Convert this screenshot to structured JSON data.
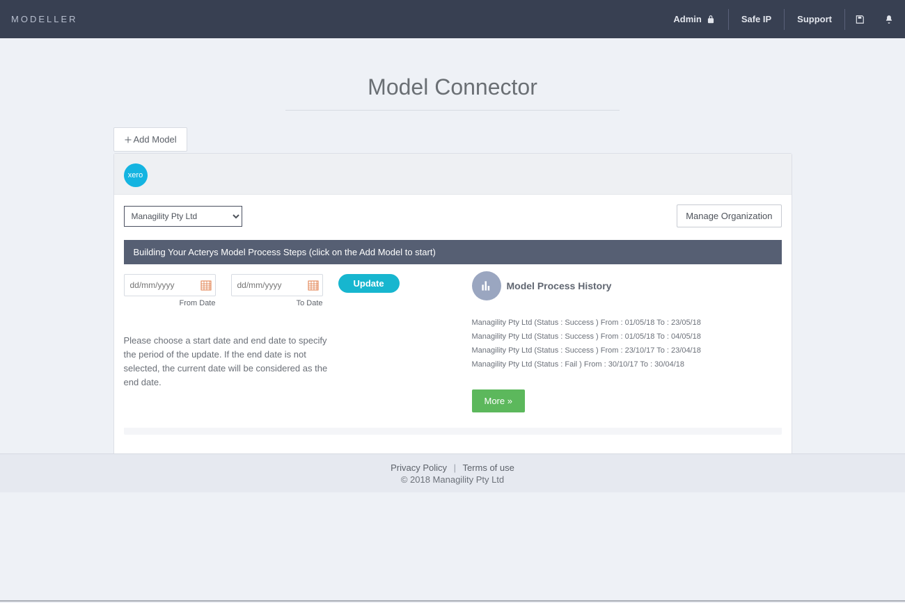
{
  "topbar": {
    "brand": "MODELLER",
    "admin_label": "Admin",
    "safe_ip_label": "Safe IP",
    "support_label": "Support"
  },
  "page": {
    "title": "Model Connector"
  },
  "actions": {
    "add_model_label": "Add Model",
    "manage_org_label": "Manage Organization",
    "update_label": "Update",
    "more_label": "More »"
  },
  "org": {
    "selected": "Managility Pty Ltd",
    "integration_label": "xero"
  },
  "steps_bar": "Building Your Acterys Model Process Steps (click on the Add Model to start)",
  "dates": {
    "from_placeholder": "dd/mm/yyyy",
    "to_placeholder": "dd/mm/yyyy",
    "from_caption": "From Date",
    "to_caption": "To Date"
  },
  "help_text": "Please choose a start date and end date to specify the period of the update. If the end date is not selected, the current date will be considered as the end date.",
  "history": {
    "title": "Model Process History",
    "items": [
      {
        "org": "Managility Pty Ltd",
        "status": "Success",
        "from": "01/05/18",
        "to": "23/05/18"
      },
      {
        "org": "Managility Pty Ltd",
        "status": "Success",
        "from": "01/05/18",
        "to": "04/05/18"
      },
      {
        "org": "Managility Pty Ltd",
        "status": "Success",
        "from": "23/10/17",
        "to": "23/04/18"
      },
      {
        "org": "Managility Pty Ltd",
        "status": "Fail",
        "from": "30/10/17",
        "to": "30/04/18"
      }
    ]
  },
  "footer": {
    "privacy_label": "Privacy Policy",
    "terms_label": "Terms of use",
    "copyright": "© 2018 Managility Pty Ltd"
  }
}
